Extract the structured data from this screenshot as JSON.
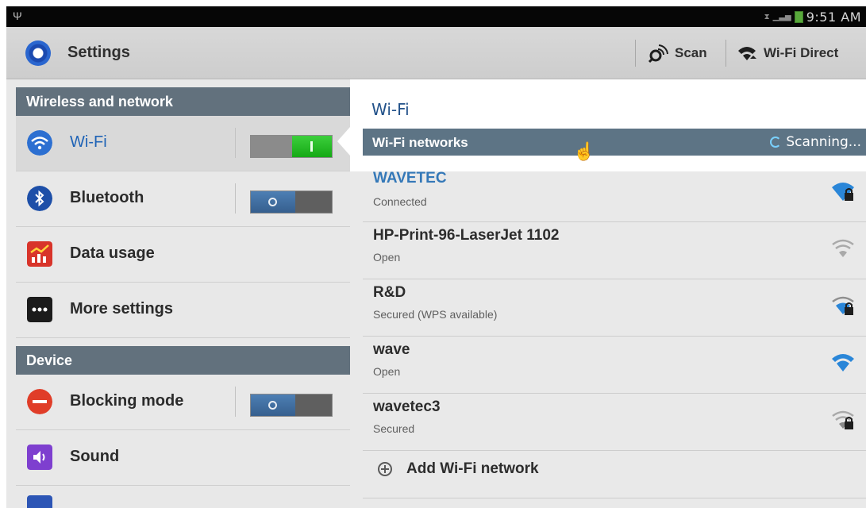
{
  "status_bar": {
    "time": "9:51 AM",
    "icons": [
      "usb-icon",
      "alarm-icon",
      "signal-icon",
      "battery-icon"
    ]
  },
  "action_bar": {
    "title": "Settings",
    "scan_label": "Scan",
    "wifi_direct_label": "Wi-Fi Direct"
  },
  "sidebar": {
    "section_wireless": "Wireless and network",
    "section_device": "Device",
    "items": [
      {
        "label": "Wi-Fi",
        "icon": "wifi-icon",
        "toggle": "on",
        "selected": true
      },
      {
        "label": "Bluetooth",
        "icon": "bluetooth-icon",
        "toggle": "off"
      },
      {
        "label": "Data usage",
        "icon": "data-usage-icon"
      },
      {
        "label": "More settings",
        "icon": "more-settings-icon"
      },
      {
        "label": "Blocking mode",
        "icon": "blocking-mode-icon",
        "toggle": "off"
      },
      {
        "label": "Sound",
        "icon": "sound-icon"
      }
    ]
  },
  "detail": {
    "title": "Wi-Fi",
    "networks_header": "Wi-Fi networks",
    "scanning_label": "Scanning...",
    "networks": [
      {
        "name": "WAVETEC",
        "status": "Connected",
        "secured": true
      },
      {
        "name": "HP-Print-96-LaserJet 1102",
        "status": "Open",
        "secured": false
      },
      {
        "name": "R&D",
        "status": "Secured (WPS available)",
        "secured": true
      },
      {
        "name": "wave",
        "status": "Open",
        "secured": false
      },
      {
        "name": "wavetec3",
        "status": "Secured",
        "secured": true
      }
    ],
    "add_network_label": "Add Wi-Fi network"
  },
  "colors": {
    "section_bar": "#62717d",
    "accent_blue": "#1f63b6",
    "toggle_on": "#15a915"
  }
}
